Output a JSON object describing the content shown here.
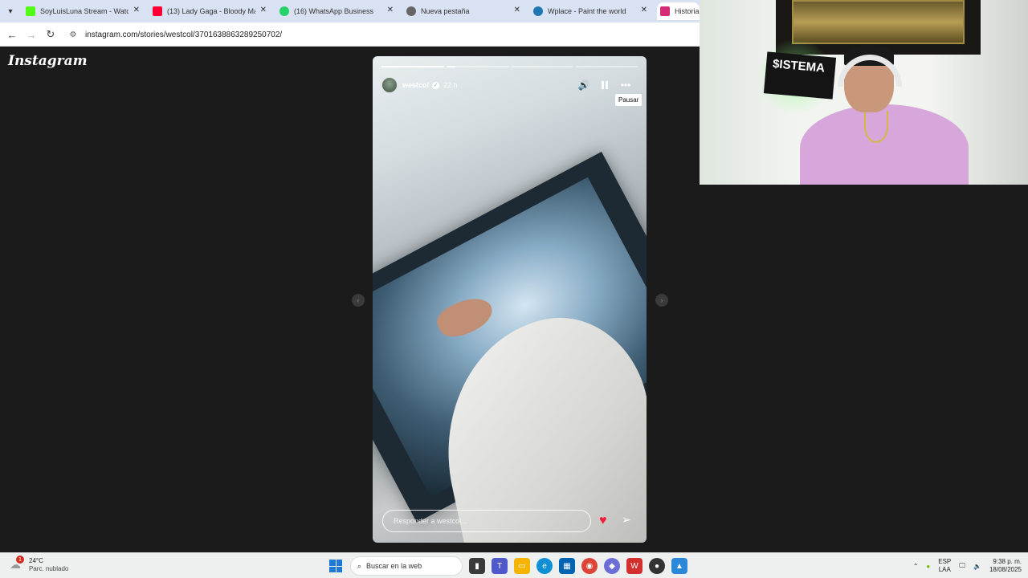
{
  "browser": {
    "tabs": [
      {
        "title": "SoyLuisLuna Stream - Watch Li",
        "favicon_color": "#53fc18"
      },
      {
        "title": "(13) Lady Gaga - Bloody Mary (",
        "favicon_color": "#ff0033"
      },
      {
        "title": "(16) WhatsApp Business",
        "favicon_color": "#25d366"
      },
      {
        "title": "Nueva pestaña",
        "favicon_color": "#666666"
      },
      {
        "title": "Wplace - Paint the world",
        "favicon_color": "#1f77b4"
      },
      {
        "title": "Historias",
        "favicon_color": "#d62976"
      }
    ],
    "url": "instagram.com/stories/westcol/3701638863289250702/"
  },
  "instagram": {
    "logo": "Instagram",
    "story": {
      "username": "westcol",
      "time": "22 h",
      "progress": [
        1.0,
        0.15,
        0.0,
        0.0
      ],
      "tooltip": "Pausar",
      "reply_placeholder": "Responder a westcol..."
    }
  },
  "webcam": {
    "sign_text": "$ISTEMA"
  },
  "taskbar": {
    "temp": "24°C",
    "weather_desc": "Parc. nublado",
    "weather_badge": "1",
    "search_placeholder": "Buscar en la web",
    "lang_1": "ESP",
    "lang_2": "LAA",
    "time": "9:38 p. m.",
    "date": "18/08/2025"
  }
}
